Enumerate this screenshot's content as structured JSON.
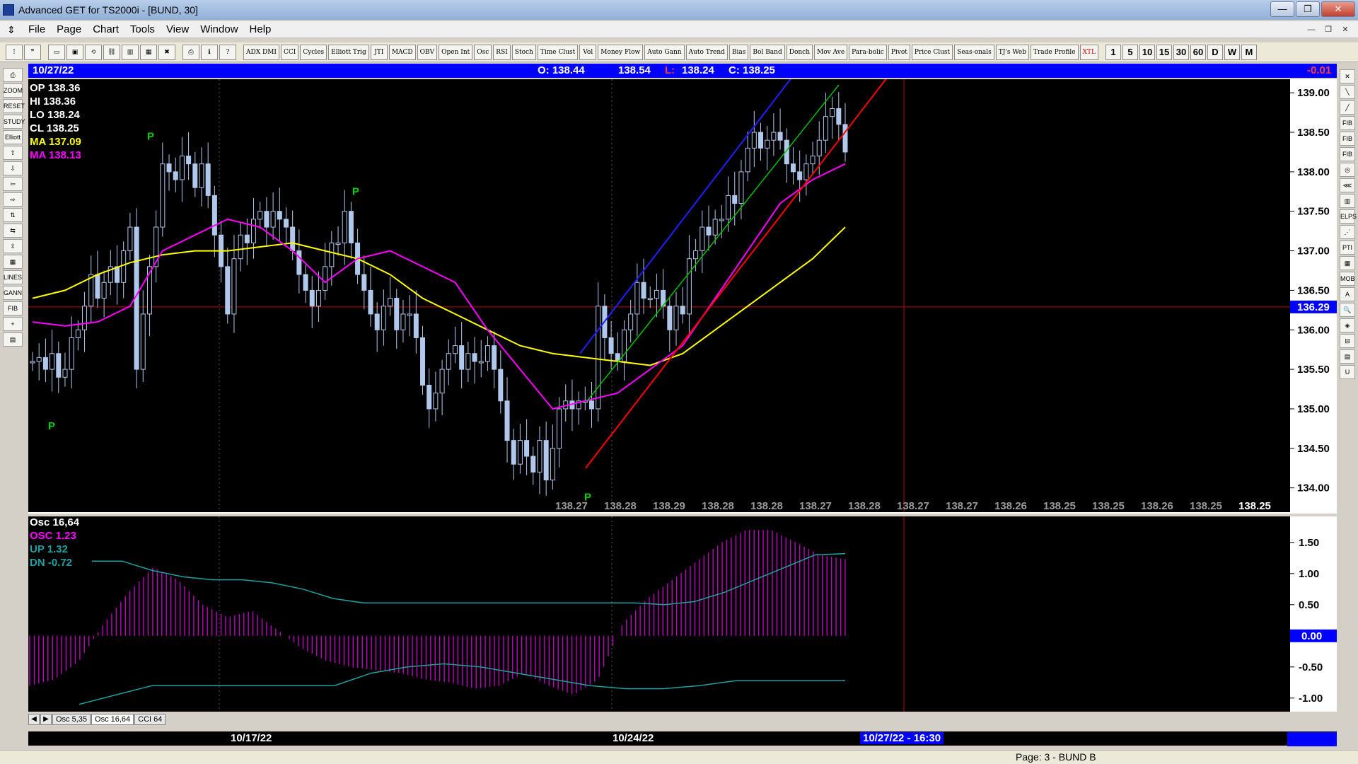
{
  "window": {
    "title": "Advanced GET for TS2000i - [BUND, 30]",
    "minimize": "—",
    "maximize": "❐",
    "close": "✕"
  },
  "menu": [
    "File",
    "Page",
    "Chart",
    "Tools",
    "View",
    "Window",
    "Help"
  ],
  "toolbar_studies": [
    "ADX DMI",
    "CCI",
    "Cycles",
    "Elliott Trig",
    "JTI",
    "MACD",
    "OBV",
    "Open Int",
    "Osc",
    "RSI",
    "Stoch",
    "Time Clust",
    "Vol",
    "Money Flow",
    "Auto Gann",
    "Auto Trend",
    "Bias",
    "Bol Band",
    "Donch",
    "Mov Ave",
    "Para-bolic",
    "Pivot",
    "Price Clust",
    "Seas-onals",
    "TJ's Web",
    "Trade Profile",
    "XTL"
  ],
  "toolbar_intervals": [
    "1",
    "5",
    "10",
    "15",
    "30",
    "60",
    "D",
    "W",
    "M"
  ],
  "left_tools": [
    "⎙",
    "ZOOM",
    "RESET",
    "STUDY",
    "Elliott",
    "⇧",
    "⇩",
    "⇦",
    "⇨",
    "⇅",
    "⇆",
    "⇳",
    "▦",
    "LINES",
    "GANN",
    "FIB",
    "+",
    "▤"
  ],
  "right_tools": [
    "✕",
    "╲",
    "╱",
    "FIB RET",
    "FIB EXT",
    "FIB TIME",
    "◎",
    "⋘",
    "▥",
    "ELPS",
    "⋰",
    "PTI",
    "▦",
    "MOB",
    "A",
    "🔍",
    "◈",
    "⊟",
    "▤",
    "U"
  ],
  "infobar": {
    "date": "10/27/22",
    "open": "O: 138.44",
    "high": "138.54",
    "low_label": "L:",
    "low": "138.24",
    "close": "C: 138.25",
    "change": "-0.01"
  },
  "price_legend": {
    "op": "OP  138.36",
    "hi": "HI   138.36",
    "lo": "LO  138.24",
    "cl": "CL  138.25",
    "ma1": "MA  137.09",
    "ma2": "MA  138.13"
  },
  "osc_legend": {
    "title": "Osc 16,64",
    "osc": "OSC 1.23",
    "up": "UP   1.32",
    "dn": "DN   -0.72"
  },
  "pivot_label": "P",
  "pivot_prices": [
    "138.27",
    "138.28",
    "138.29",
    "138.28",
    "138.28",
    "138.27",
    "138.28",
    "138.27",
    "138.27",
    "138.26",
    "138.25",
    "138.25",
    "138.26",
    "138.25",
    "138.25"
  ],
  "current_price": "136.29",
  "osc_zero_label": "0.00",
  "tabs": [
    "Osc 5,35",
    "Osc 16,64",
    "CCI 64"
  ],
  "tab_nav": [
    "◀",
    "▶"
  ],
  "dates": [
    "10/17/22",
    "10/24/22",
    "10/27/22 - 16:30"
  ],
  "status": "Page: 3 - BUND B",
  "colors": {
    "infobar_bg": "#0000ff",
    "candle": "#b0c8ec",
    "ma_yellow": "#ffff00",
    "ma_magenta": "#ff00ff",
    "pivot_green": "#00d000",
    "channel_blue": "#2020ff",
    "channel_green": "#00c000",
    "channel_red": "#ff0000",
    "osc_bars": "#c000c0",
    "osc_bands": "#20a0a0"
  },
  "chart_data": [
    {
      "type": "candlestick",
      "ylim": [
        133.8,
        139.1
      ],
      "yticks": [
        "139.00",
        "138.50",
        "138.00",
        "137.50",
        "137.00",
        "136.50",
        "136.00",
        "135.50",
        "135.00",
        "134.50",
        "134.00"
      ],
      "close_series": [
        135.6,
        135.65,
        135.5,
        135.7,
        135.4,
        135.5,
        135.9,
        136.0,
        136.3,
        136.7,
        136.4,
        136.6,
        136.8,
        136.6,
        137.0,
        137.3,
        135.5,
        136.2,
        136.8,
        137.3,
        138.1,
        138.0,
        137.9,
        138.2,
        138.1,
        137.8,
        138.1,
        137.7,
        137.2,
        136.8,
        136.2,
        136.9,
        137.2,
        137.1,
        137.4,
        137.5,
        137.3,
        137.5,
        137.4,
        137.3,
        137.0,
        136.7,
        136.5,
        136.3,
        136.5,
        136.8,
        137.1,
        137.1,
        137.5,
        137.1,
        136.7,
        136.5,
        136.2,
        136.0,
        136.3,
        136.4,
        136.0,
        136.2,
        136.2,
        135.9,
        135.3,
        135.0,
        135.2,
        135.5,
        135.7,
        135.8,
        135.5,
        135.7,
        135.6,
        135.6,
        135.8,
        135.5,
        135.1,
        134.6,
        134.3,
        134.6,
        134.4,
        134.2,
        134.6,
        134.1,
        134.5,
        135.0,
        135.1,
        135.0,
        135.1,
        135.1,
        135.0,
        136.3,
        135.9,
        135.7,
        135.6,
        136.0,
        136.2,
        136.6,
        136.4,
        136.4,
        136.5,
        136.3,
        136.0,
        136.3,
        136.2,
        136.9,
        137.0,
        137.3,
        137.2,
        137.4,
        137.4,
        137.7,
        137.6,
        138.0,
        138.3,
        138.5,
        138.3,
        138.4,
        138.5,
        138.4,
        138.1,
        138.0,
        137.9,
        138.1,
        138.2,
        138.4,
        138.7,
        138.8,
        138.6,
        138.25
      ],
      "ma_yellow_series": [
        136.4,
        136.5,
        136.7,
        136.85,
        136.95,
        137.0,
        137.0,
        137.05,
        137.1,
        137.0,
        136.9,
        136.7,
        136.4,
        136.2,
        136.0,
        135.8,
        135.7,
        135.65,
        135.6,
        135.55,
        135.7,
        136.0,
        136.3,
        136.6,
        136.9,
        137.3
      ],
      "ma_magenta_series": [
        136.1,
        136.05,
        136.1,
        136.3,
        137.0,
        137.2,
        137.4,
        137.3,
        137.0,
        136.6,
        136.9,
        137.0,
        136.8,
        136.6,
        136.0,
        135.5,
        135.0,
        135.1,
        135.2,
        135.5,
        135.8,
        136.4,
        137.0,
        137.6,
        137.9,
        138.1
      ],
      "current_price": 136.29
    },
    {
      "type": "bar",
      "ylim": [
        -1.15,
        1.85
      ],
      "yticks": [
        "1.50",
        "1.00",
        "0.50",
        "0.00",
        "-0.50",
        "-1.00"
      ],
      "osc_series": [
        -0.8,
        -0.7,
        -0.4,
        0.2,
        0.7,
        1.1,
        0.9,
        0.5,
        0.3,
        0.4,
        0.1,
        -0.2,
        -0.4,
        -0.5,
        -0.55,
        -0.6,
        -0.7,
        -0.75,
        -0.85,
        -0.8,
        -0.6,
        -0.8,
        -0.95,
        -0.7,
        0.2,
        0.6,
        0.9,
        1.2,
        1.5,
        1.7,
        1.7,
        1.5,
        1.3,
        1.23
      ],
      "up_series": [
        1.2,
        1.2,
        1.05,
        0.95,
        0.9,
        0.9,
        0.85,
        0.75,
        0.6,
        0.53,
        0.53,
        0.53,
        0.53,
        0.53,
        0.53,
        0.53,
        0.53,
        0.53,
        0.53,
        0.5,
        0.55,
        0.7,
        0.9,
        1.1,
        1.3,
        1.32
      ],
      "dn_series": [
        -1.1,
        -0.95,
        -0.8,
        -0.8,
        -0.8,
        -0.8,
        -0.8,
        -0.8,
        -0.6,
        -0.5,
        -0.45,
        -0.5,
        -0.6,
        -0.7,
        -0.8,
        -0.85,
        -0.85,
        -0.8,
        -0.72,
        -0.72,
        -0.72,
        -0.72
      ]
    }
  ]
}
